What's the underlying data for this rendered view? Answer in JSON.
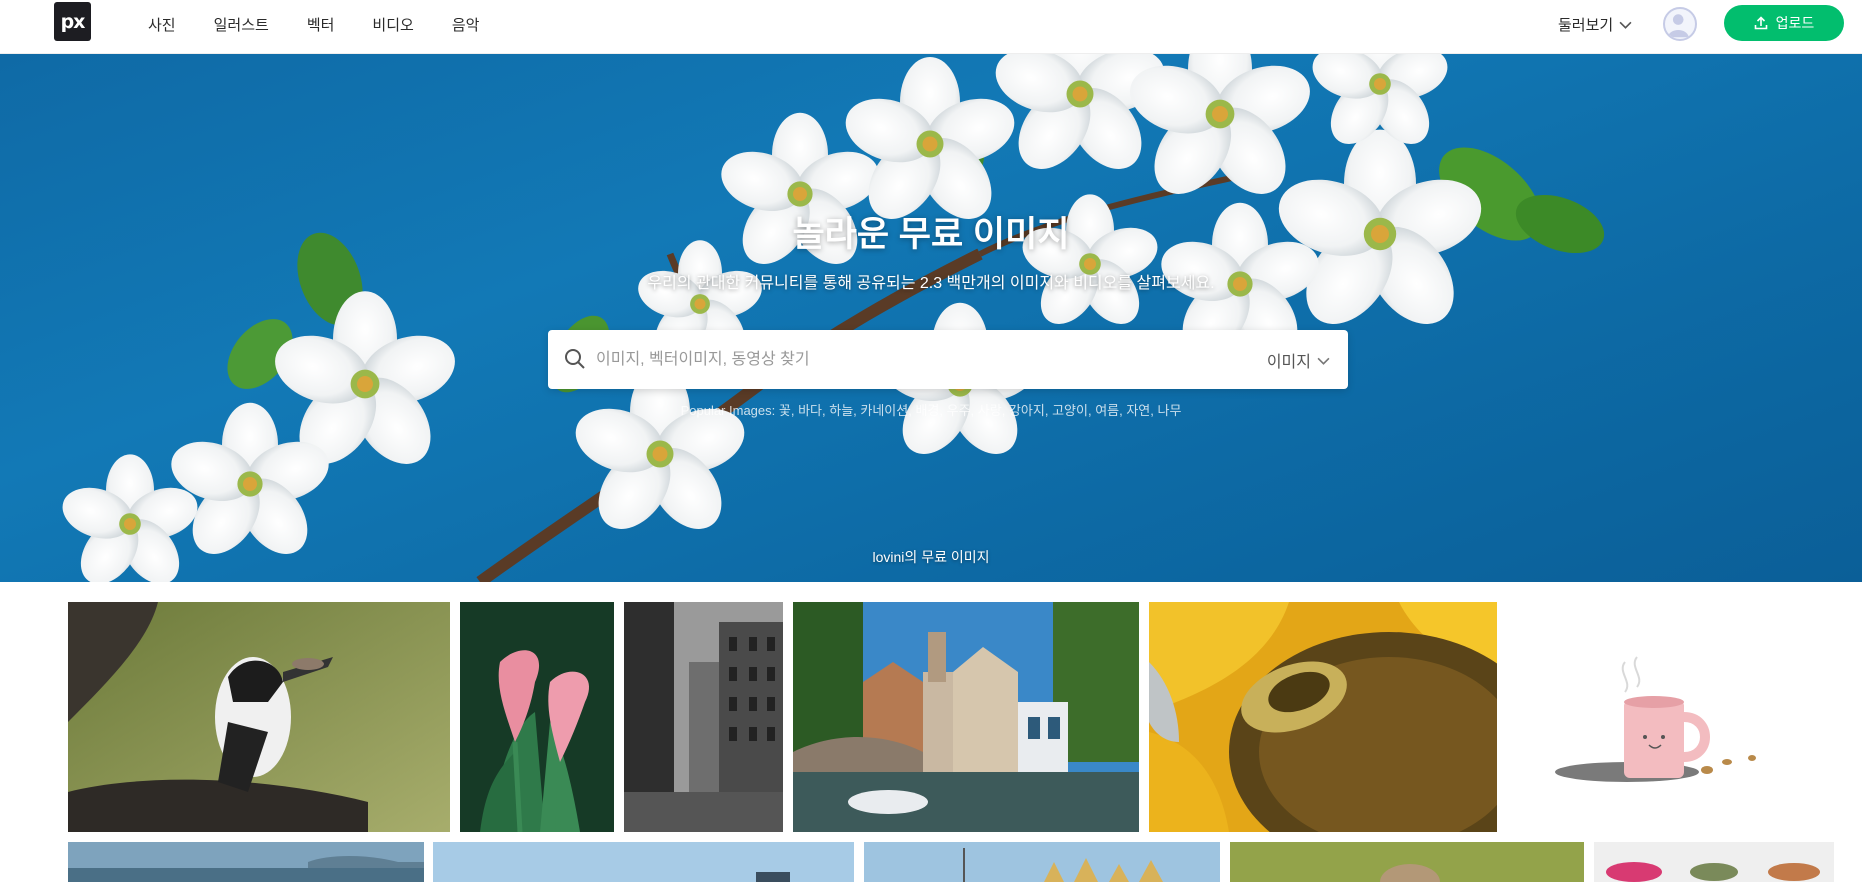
{
  "brand": {
    "logo_text": "px"
  },
  "nav": [
    {
      "label": "사진"
    },
    {
      "label": "일러스트"
    },
    {
      "label": "벡터"
    },
    {
      "label": "비디오"
    },
    {
      "label": "음악"
    }
  ],
  "header": {
    "explore_label": "둘러보기",
    "upload_label": "업로드"
  },
  "hero": {
    "title": "놀라운 무료 이미지",
    "subtitle": "우리의 관대한 커뮤니티를 통해 공유되는 2.3 백만개의 이미지와 비디오를 살펴보세요.",
    "search_placeholder": "이미지, 벡터이미지, 동영상 찾기",
    "search_type": "이미지",
    "popular_prefix": "Popular Images:",
    "popular_tags": [
      "꽃",
      "바다",
      "하늘",
      "카네이션",
      "배경",
      "우주",
      "사랑",
      "강아지",
      "고양이",
      "여름",
      "자연",
      "나무"
    ],
    "credit": "lovini의 무료 이미지"
  },
  "gallery": {
    "row1": [
      "kingfisher-photo",
      "calla-lily-photo",
      "city-street-bw-photo",
      "canal-town-photo",
      "sunflower-bee-photo",
      "pink-mug-illustration"
    ],
    "row2": [
      "sea-horizon-photo",
      "sky-photo",
      "harbor-houses-photo",
      "meadow-photo",
      "pink-leaves-photo"
    ]
  }
}
